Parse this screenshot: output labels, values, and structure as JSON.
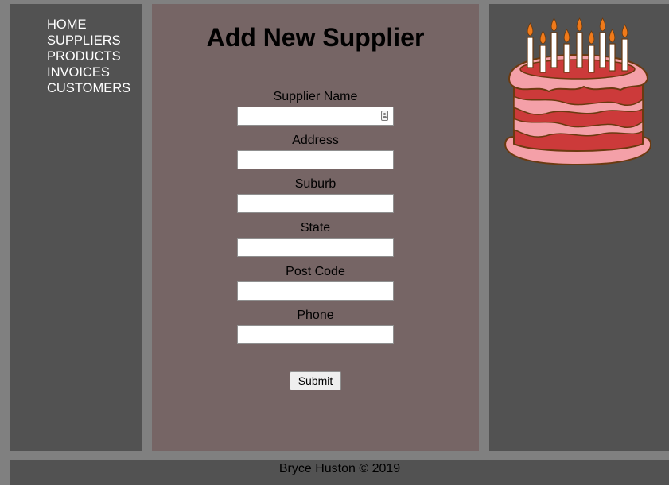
{
  "nav": {
    "items": [
      {
        "label": "HOME"
      },
      {
        "label": "SUPPLIERS"
      },
      {
        "label": "PRODUCTS"
      },
      {
        "label": "INVOICES"
      },
      {
        "label": "CUSTOMERS"
      }
    ]
  },
  "form": {
    "title": "Add New Supplier",
    "fields": [
      {
        "label": "Supplier Name",
        "value": ""
      },
      {
        "label": "Address",
        "value": ""
      },
      {
        "label": "Suburb",
        "value": ""
      },
      {
        "label": "State",
        "value": ""
      },
      {
        "label": "Post Code",
        "value": ""
      },
      {
        "label": "Phone",
        "value": ""
      }
    ],
    "submit_label": "Submit"
  },
  "aside": {
    "image": "birthday-cake-icon"
  },
  "footer": {
    "text": "Bryce Huston © 2019"
  },
  "colors": {
    "page_bg": "#808080",
    "panel_dark": "#525252",
    "main_panel": "#766565",
    "nav_text": "#ffffff",
    "cake_red": "#cc3a3a",
    "cake_pink": "#f4a0a8",
    "flame": "#f07a1a"
  }
}
